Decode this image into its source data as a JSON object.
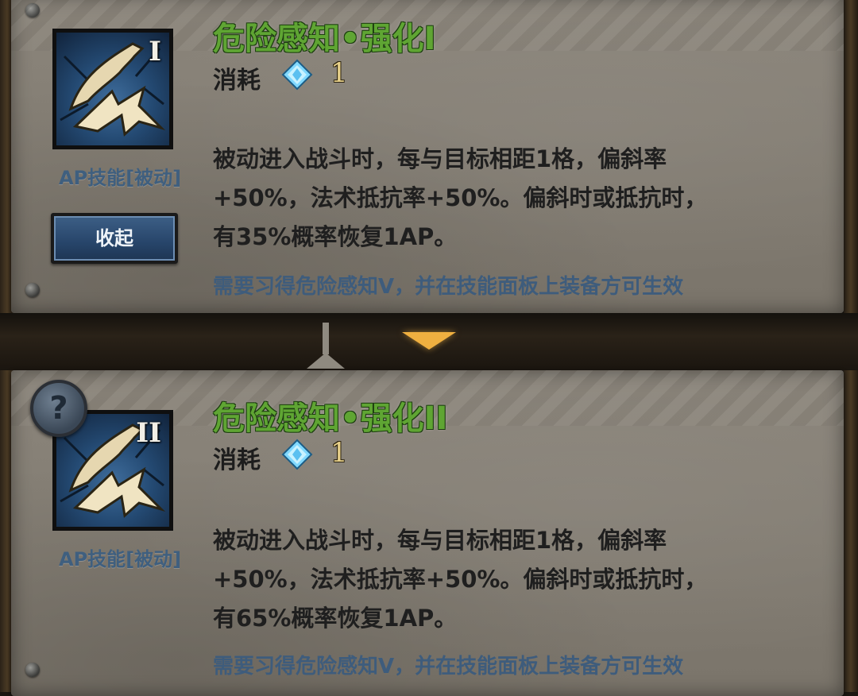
{
  "skill_1": {
    "roman": "I",
    "title": "危险感知•强化I",
    "type_label": "AP技能[被动]",
    "cost_label": "消耗",
    "cost_value": "1",
    "desc_lines": [
      "被动进入战斗时，每与目标相距1格，偏斜率",
      "+50%，法术抵抗率+50%。偏斜时或抵抗时，",
      "有35%概率恢复1AP。"
    ],
    "requirement": "需要习得危险感知V，并在技能面板上装备方可生效",
    "collapse_label": "收起"
  },
  "skill_2": {
    "roman": "II",
    "title": "危险感知•强化II",
    "type_label": "AP技能[被动]",
    "cost_label": "消耗",
    "cost_value": "1",
    "desc_lines": [
      "被动进入战斗时，每与目标相距1格，偏斜率",
      "+50%，法术抵抗率+50%。偏斜时或抵抗时，",
      "有65%概率恢复1AP。"
    ],
    "requirement": "需要习得危险感知V，并在技能面板上装备方可生效",
    "help_label": "?"
  },
  "icons": {
    "skill_icon": "hound-leap-arrow-icon",
    "cost_icon": "blue-gem-icon",
    "expand_icon": "chevron-down-icon",
    "help_icon": "question-mark-icon"
  },
  "colors": {
    "title_green": "#5fa533",
    "requirement_blue": "#3e5c7c",
    "panel_stone": "#837d73",
    "expand_gold": "#f0b040"
  }
}
